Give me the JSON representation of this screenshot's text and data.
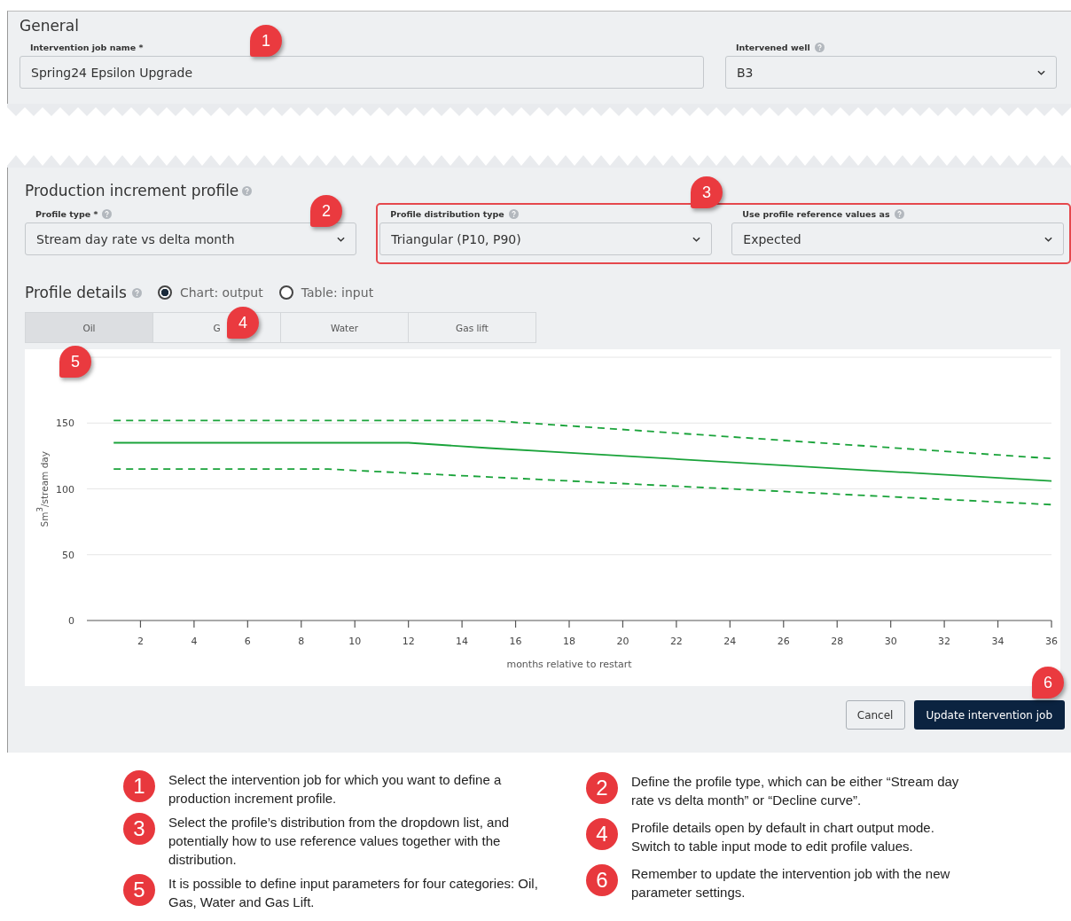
{
  "general": {
    "title": "General",
    "job_name": {
      "label": "Intervention job name *",
      "value": "Spring24 Epsilon Upgrade"
    },
    "well": {
      "label": "Intervened well",
      "value": "B3"
    }
  },
  "production": {
    "title": "Production increment profile",
    "profile_type": {
      "label": "Profile type *",
      "value": "Stream day rate vs delta month"
    },
    "distribution": {
      "label": "Profile distribution type",
      "value": "Triangular (P10, P90)"
    },
    "reference": {
      "label": "Use profile reference values as",
      "value": "Expected"
    }
  },
  "profile_details": {
    "title": "Profile details",
    "modes": [
      {
        "label": "Chart: output",
        "selected": true
      },
      {
        "label": "Table: input",
        "selected": false
      }
    ],
    "tabs": [
      {
        "label": "Oil",
        "selected": true
      },
      {
        "label": "G",
        "selected": false
      },
      {
        "label": "Water",
        "selected": false
      },
      {
        "label": "Gas lift",
        "selected": false
      }
    ],
    "chart_data": {
      "type": "line",
      "ylabel": "Sm$^{3}$/stream day",
      "xlabel": "months relative to restart",
      "x": [
        1,
        9,
        12,
        15,
        36
      ],
      "series": [
        {
          "color": "#1aa33a",
          "line_style": "dashed",
          "values": [
            152,
            152,
            152,
            152,
            123
          ]
        },
        {
          "color": "#1aa33a",
          "line_style": "solid",
          "values": [
            135,
            135,
            135,
            131,
            106
          ]
        },
        {
          "color": "#1aa33a",
          "line_style": "dashed",
          "values": [
            115,
            115,
            112,
            109,
            88
          ]
        }
      ],
      "grid": true,
      "xlim": [
        0,
        36
      ],
      "ylim": [
        0,
        200
      ],
      "xticks": [
        2,
        4,
        6,
        8,
        10,
        12,
        14,
        16,
        18,
        20,
        22,
        24,
        26,
        28,
        30,
        32,
        34,
        36
      ],
      "yticks": [
        0,
        50,
        100,
        150
      ]
    },
    "cancel": "Cancel",
    "update": "Update intervention job"
  },
  "callouts": [
    "1",
    "2",
    "3",
    "4",
    "5",
    "6"
  ],
  "notes": [
    {
      "number": "1",
      "text": "Select the intervention job for which you want to define a production increment profile."
    },
    {
      "number": "3",
      "text": "Select the profile’s distribution from the dropdown list, and potentially how to use reference values together with the distribution."
    },
    {
      "number": "5",
      "text": "It is possible to define input parameters for four categories: Oil, Gas, Water and Gas Lift."
    },
    {
      "number": "2",
      "text": "Define the profile type, which can be either “Stream day rate vs delta month” or “Decline curve”."
    },
    {
      "number": "4",
      "text": "Profile details open by default in chart output mode. Switch to table input mode to edit profile values."
    },
    {
      "number": "6",
      "text": "Remember to update the intervention job with the new parameter settings."
    }
  ]
}
